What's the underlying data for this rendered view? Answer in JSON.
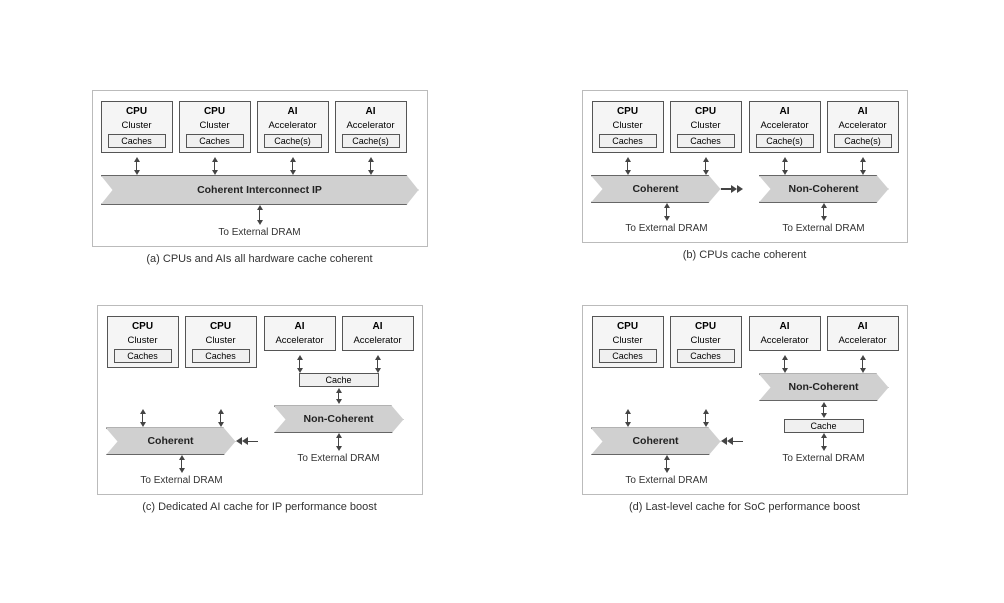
{
  "diagrams": [
    {
      "id": "a",
      "caption": "(a) CPUs and AIs all hardware cache coherent",
      "clusters": [
        {
          "title": "CPU",
          "sub": "Cluster",
          "cache": "Caches"
        },
        {
          "title": "CPU",
          "sub": "Cluster",
          "cache": "Caches"
        },
        {
          "title": "AI",
          "sub": "Accelerator",
          "cache": "Cache(s)"
        },
        {
          "title": "AI",
          "sub": "Accelerator",
          "cache": "Cache(s)"
        }
      ],
      "banner": "Coherent Interconnect IP",
      "banner_type": "single",
      "dram_labels": [
        "To External DRAM"
      ]
    },
    {
      "id": "b",
      "caption": "(b) CPUs cache coherent",
      "clusters_left": [
        {
          "title": "CPU",
          "sub": "Cluster",
          "cache": "Caches"
        },
        {
          "title": "CPU",
          "sub": "Cluster",
          "cache": "Caches"
        }
      ],
      "clusters_right": [
        {
          "title": "AI",
          "sub": "Accelerator",
          "cache": "Cache(s)"
        },
        {
          "title": "AI",
          "sub": "Accelerator",
          "cache": "Cache(s)"
        }
      ],
      "banner_left": "Coherent",
      "banner_right": "Non-Coherent",
      "banner_type": "dual",
      "dram_labels": [
        "To External DRAM",
        "To External DRAM"
      ]
    },
    {
      "id": "c",
      "caption": "(c) Dedicated AI cache for IP performance boost",
      "clusters_left": [
        {
          "title": "CPU",
          "sub": "Cluster",
          "cache": "Caches"
        },
        {
          "title": "CPU",
          "sub": "Cluster",
          "cache": "Caches"
        }
      ],
      "clusters_right": [
        {
          "title": "AI",
          "sub": "Accelerator",
          "cache": null
        },
        {
          "title": "AI",
          "sub": "Accelerator",
          "cache": null
        }
      ],
      "ai_cache": "Cache",
      "banner_left": "Coherent",
      "banner_right": "Non-Coherent",
      "banner_type": "dual_with_ai_cache",
      "dram_labels": [
        "To External DRAM",
        "To External DRAM"
      ]
    },
    {
      "id": "d",
      "caption": "(d) Last-level cache for SoC performance boost",
      "clusters_left": [
        {
          "title": "CPU",
          "sub": "Cluster",
          "cache": "Caches"
        },
        {
          "title": "CPU",
          "sub": "Cluster",
          "cache": "Caches"
        }
      ],
      "clusters_right": [
        {
          "title": "AI",
          "sub": "Accelerator",
          "cache": null
        },
        {
          "title": "AI",
          "sub": "Accelerator",
          "cache": null
        }
      ],
      "shared_cache": "Cache",
      "banner_left": "Coherent",
      "banner_right": "Non-Coherent",
      "banner_type": "dual_with_shared_cache",
      "dram_labels": [
        "To External DRAM",
        "To External DRAM"
      ]
    }
  ]
}
